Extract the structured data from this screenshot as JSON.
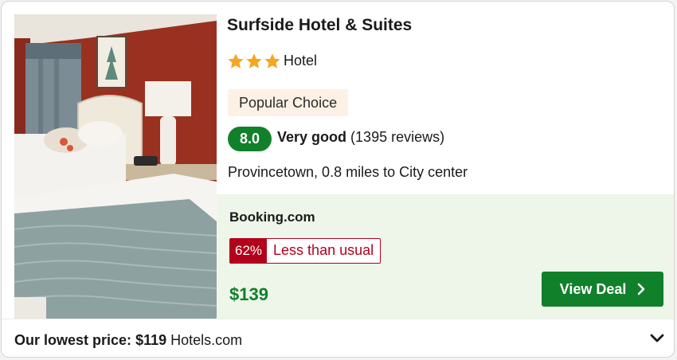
{
  "hotel": {
    "name": "Surfside Hotel & Suites",
    "star_count": 3,
    "type": "Hotel",
    "badge": "Popular Choice",
    "score": "8.0",
    "rating_word": "Very good",
    "reviews": "(1395 reviews)",
    "location": "Provincetown, 0.8 miles to City center",
    "photo_icon": "hotel-room-photo"
  },
  "deal": {
    "provider": "Booking.com",
    "discount_pct": "62%",
    "discount_text": "Less than usual",
    "price": "$139",
    "cta": "View Deal"
  },
  "footer": {
    "label": "Our lowest price:",
    "price": "$119",
    "provider": "Hotels.com"
  },
  "colors": {
    "green": "#11802b",
    "star": "#f5a623",
    "discount_red": "#b3001b",
    "deal_bg": "#eef6e9",
    "badge_bg": "#fdf0e4"
  }
}
